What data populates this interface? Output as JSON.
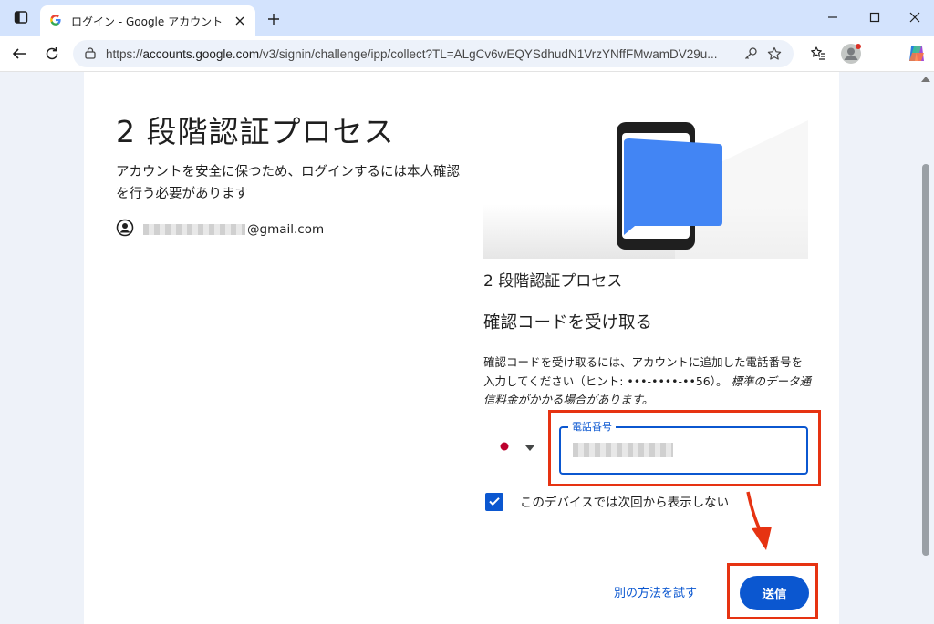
{
  "browser": {
    "tab_title": "ログイン - Google アカウント",
    "url_scheme": "https://",
    "url_host": "accounts.google.com",
    "url_path": "/v3/signin/challenge/ipp/collect?TL=ALgCv6wEQYSdhudN1VrzYNffFMwamDV29u..."
  },
  "page": {
    "title": "2 段階認証プロセス",
    "description": "アカウントを安全に保つため、ログインするには本人確認を行う必要があります",
    "account_email_suffix": "@gmail.com",
    "right_subtitle": "2 段階認証プロセス",
    "right_heading": "確認コードを受け取る",
    "info_text": "確認コードを受け取るには、アカウントに追加した電話番号を入力してください（ヒント: •••-••••-••56）。",
    "info_italic": "標準のデータ通信料金がかかる場合があります。",
    "phone_label": "電話番号",
    "checkbox_label": "このデバイスでは次回から表示しない",
    "checkbox_checked": true,
    "alt_method_label": "別の方法を試す",
    "submit_label": "送信"
  },
  "colors": {
    "accent": "#0b57d0",
    "highlight": "#e63312",
    "tabbar": "#d3e3fd"
  },
  "icons": [
    "browser-sidebar-icon",
    "google-g-icon",
    "close-icon",
    "plus-icon",
    "minimize-icon",
    "maximize-icon",
    "window-close-icon",
    "back-icon",
    "reload-icon",
    "site-info-icon",
    "key-icon",
    "star-icon",
    "favorites-icon",
    "profile-avatar-icon",
    "copilot-icon",
    "account-circle-icon",
    "japan-flag-icon",
    "dropdown-arrow-icon",
    "checkmark-icon",
    "red-arrow-icon"
  ]
}
